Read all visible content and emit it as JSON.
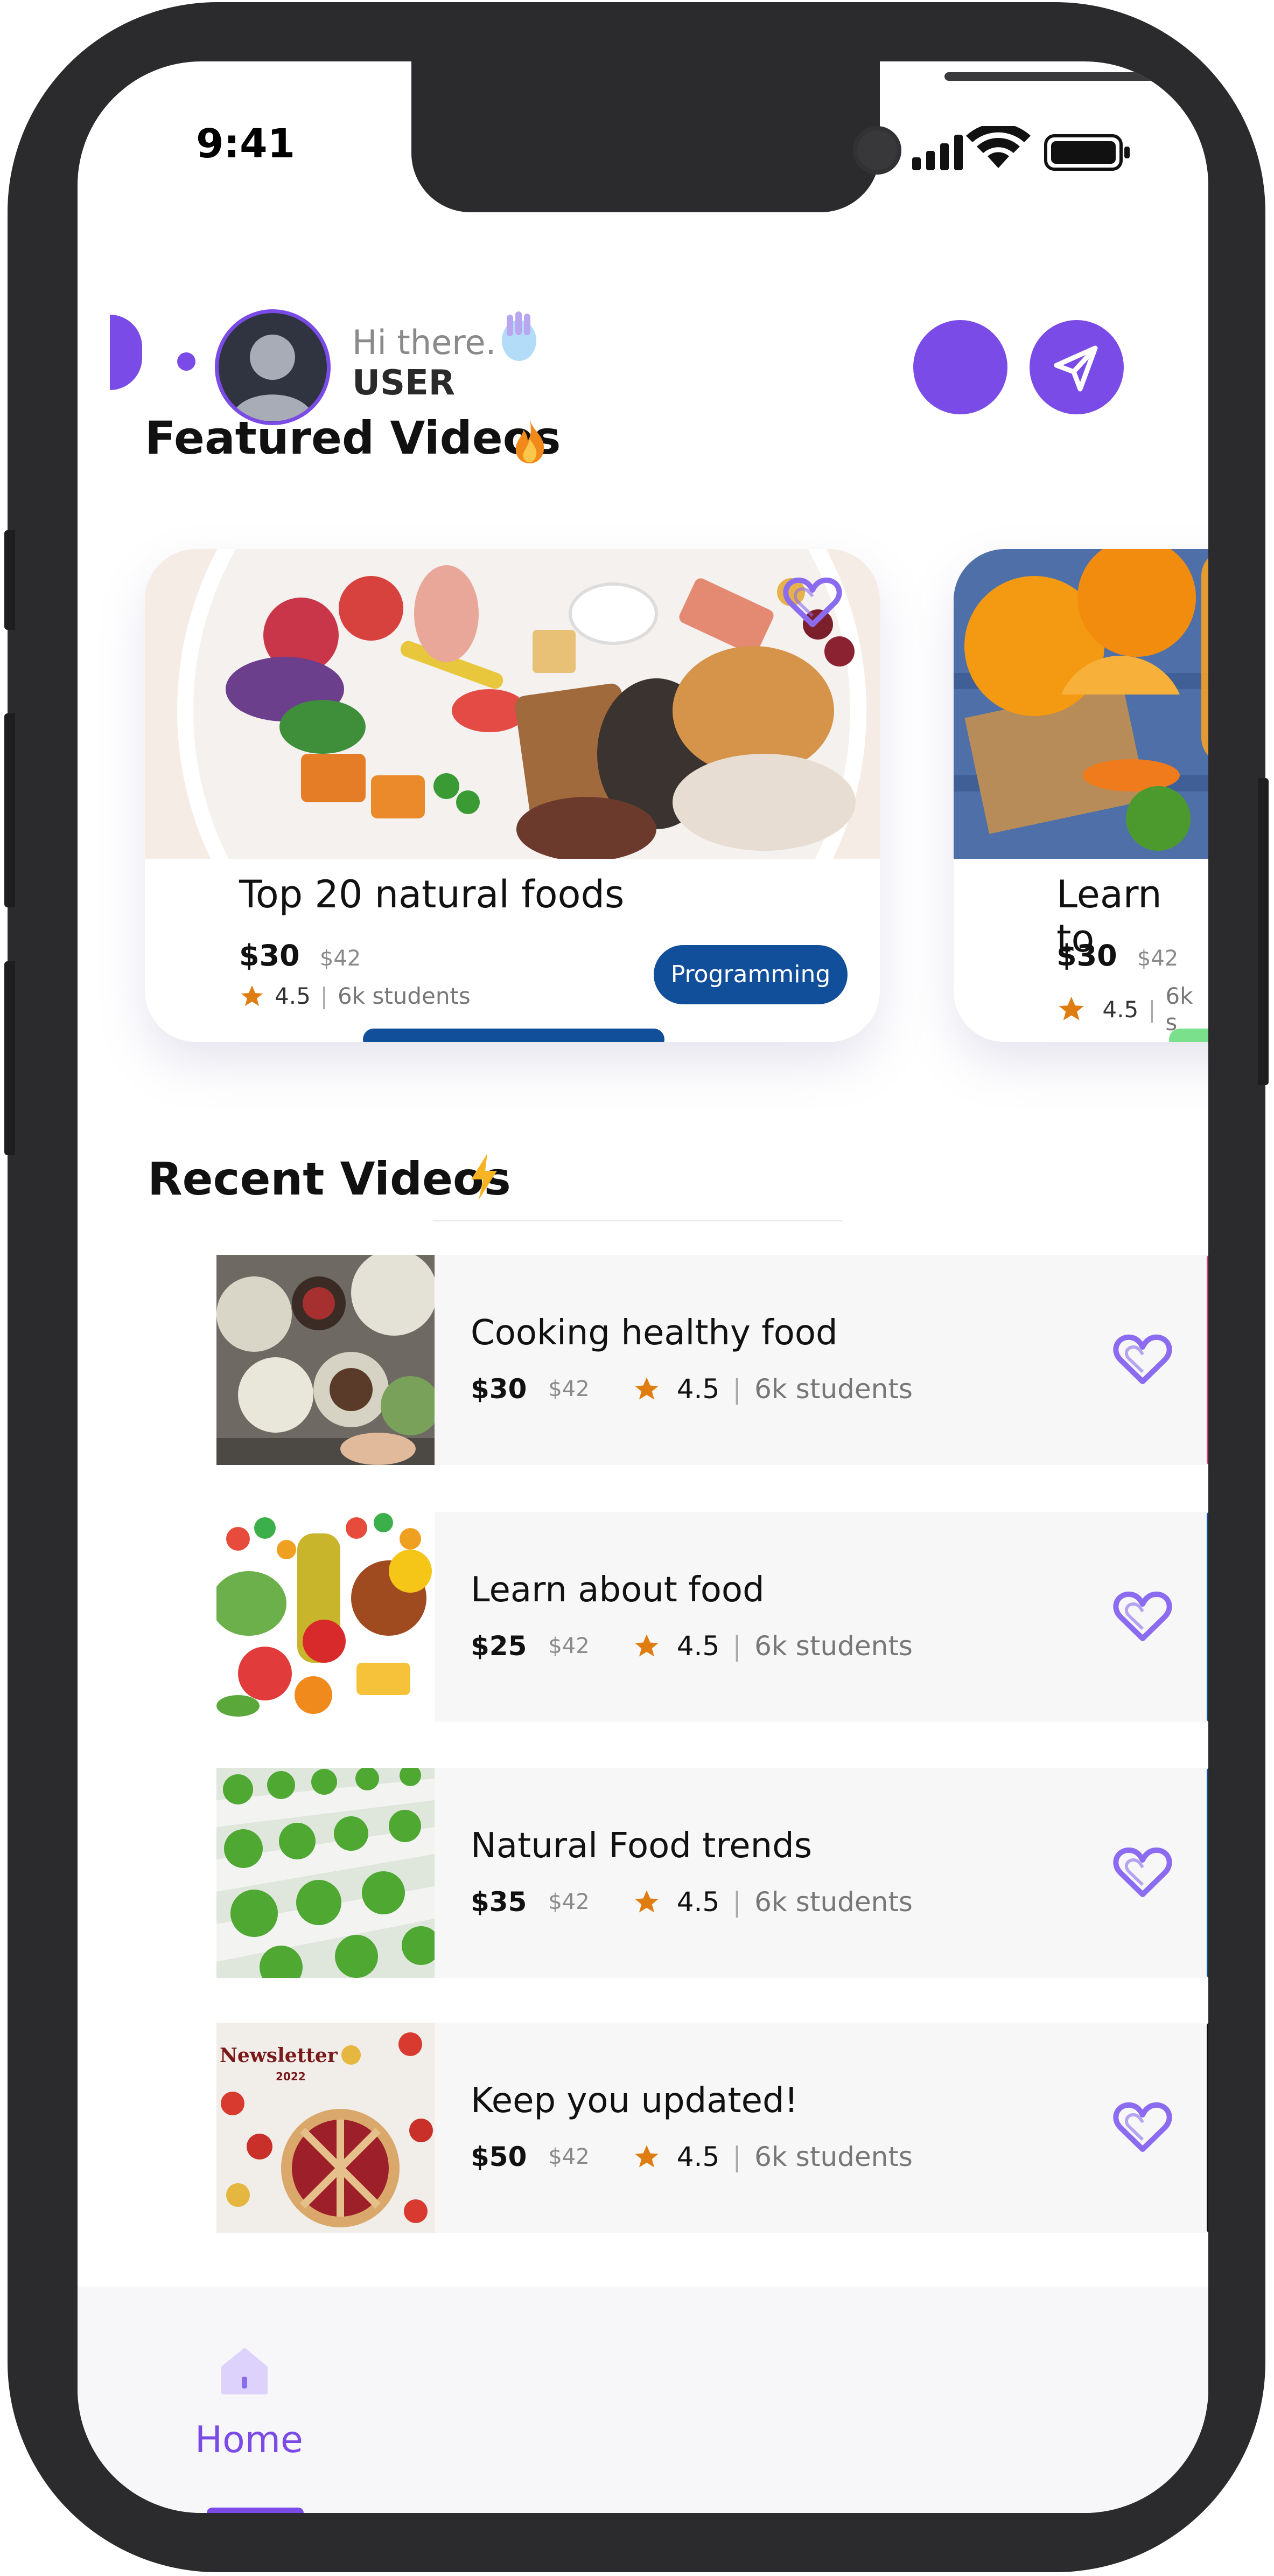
{
  "status_bar": {
    "time": "9:41"
  },
  "header": {
    "greeting": "Hi there.",
    "username": "USER"
  },
  "featured": {
    "title": "Featured Videos",
    "cards": [
      {
        "title": "Top 20 natural foods",
        "price": "$30",
        "old_price": "$42",
        "rating": "4.5",
        "students": "6k students",
        "tag": "Programming"
      },
      {
        "title": "Learn to",
        "price": "$30",
        "old_price": "$42",
        "rating": "4.5",
        "students": "6k s"
      }
    ]
  },
  "recent": {
    "title": "Recent Videos",
    "items": [
      {
        "title": "Cooking healthy food",
        "price": "$30",
        "old_price": "$42",
        "rating": "4.5",
        "students": "6k students",
        "accent": "#d2456f"
      },
      {
        "title": "Learn about food",
        "price": "$25",
        "old_price": "$42",
        "rating": "4.5",
        "students": "6k students",
        "accent": "#124f9a"
      },
      {
        "title": "Natural Food trends",
        "price": "$35",
        "old_price": "$42",
        "rating": "4.5",
        "students": "6k students",
        "accent": "#124f9a"
      },
      {
        "title": "Keep you updated!",
        "price": "$50",
        "old_price": "$42",
        "rating": "4.5",
        "students": "6k students",
        "accent": "#111111",
        "image_text": "Newsletter",
        "image_year": "2022"
      }
    ]
  },
  "nav": {
    "home_label": "Home"
  },
  "colors": {
    "accent": "#7a4be6",
    "tag": "#124f9a",
    "star": "#e07d10"
  }
}
